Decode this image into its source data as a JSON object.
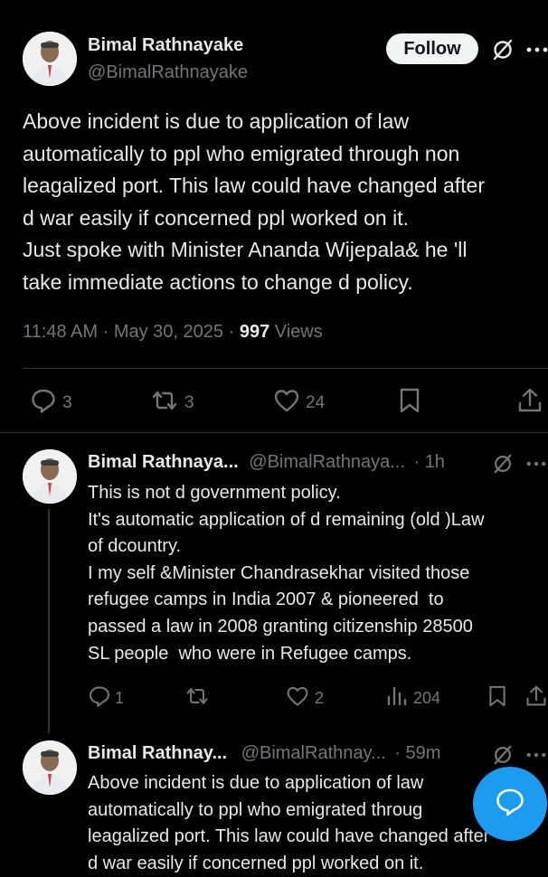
{
  "main_post": {
    "author_name": "Bimal Rathnayake",
    "author_handle": "@BimalRathnayake",
    "follow_label": "Follow",
    "text_lines": [
      "Above incident is due to application of law",
      "automatically to ppl who emigrated through non",
      "leagalized port. This law could have changed after",
      "d war easily if concerned ppl worked on it.",
      "Just spoke with Minister Ananda Wijepala& he 'll",
      "take immediate actions to change d policy."
    ],
    "time": "11:48 AM",
    "date": "May 30, 2025",
    "views_count": "997",
    "views_label": "Views",
    "replies": "3",
    "reposts": "3",
    "likes": "24"
  },
  "reply1": {
    "author_name": "Bimal Rathnaya...",
    "author_handle": "@BimalRathnaya...",
    "age": "1h",
    "text_lines": [
      "This is not d government policy.",
      "It's automatic application of d remaining (old )Law",
      "of dcountry.",
      "I my self &Minister Chandrasekhar visited those",
      "refugee camps in India 2007 & pioneered  to",
      "passed a law in 2008 granting citizenship 28500",
      "SL people  who were in Refugee camps."
    ],
    "replies": "1",
    "reposts": "",
    "likes": "2",
    "views": "204"
  },
  "reply2": {
    "author_name": "Bimal Rathnay...",
    "author_handle": "@BimalRathnay...",
    "age": "59m",
    "text_lines": [
      "Above incident is due to application of law",
      "automatically to ppl who emigrated throug",
      "leagalized port. This law could have changed after",
      "d war easily if concerned ppl worked on it."
    ]
  },
  "separator": "·",
  "colors": {
    "accent": "#1d9bf0",
    "background": "#000000",
    "muted": "#71767b",
    "text": "#e7e9ea"
  },
  "icons": [
    "grok-icon",
    "more-icon",
    "reply-icon",
    "repost-icon",
    "like-icon",
    "bookmark-icon",
    "share-icon",
    "views-icon",
    "compose-icon"
  ]
}
